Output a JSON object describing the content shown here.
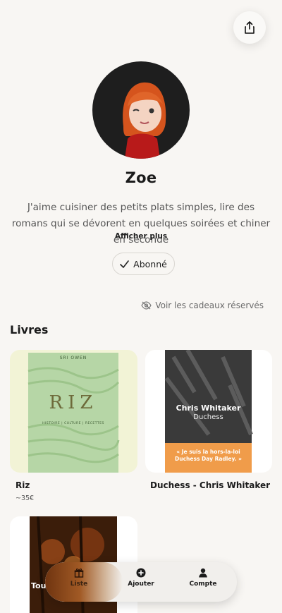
{
  "profile": {
    "name": "Zoe",
    "bio": "J'aime cuisiner des petits plats simples, lire des romans qui se dévorent en quelques soirées et chiner en seconde",
    "show_more": "Afficher plus",
    "follow_label": "Abonné",
    "reserved_link": "Voir les cadeaux réservés"
  },
  "section_title": "Livres",
  "books": [
    {
      "title": "Riz",
      "price": "~35€",
      "cover_author": "SRI OWEN",
      "cover_title": "RIZ",
      "cover_subtitle": "HISTOIRE | CULTURE | RECETTES"
    },
    {
      "title": "Duchess - Chris Whitaker",
      "cover_author": "Chris Whitaker",
      "cover_title": "Duchess",
      "cover_quote": "« Je suis la hors-la-loi Duchess Day Radley. »"
    },
    {
      "cover_title": "Tou"
    }
  ],
  "nav": [
    {
      "label": "Liste",
      "icon": "gift-icon"
    },
    {
      "label": "Ajouter",
      "icon": "plus-circle-icon"
    },
    {
      "label": "Compte",
      "icon": "user-icon"
    }
  ],
  "colors": {
    "background": "#f8f6f3",
    "accent": "#f0a04b",
    "nav_active": "#8a4516"
  }
}
